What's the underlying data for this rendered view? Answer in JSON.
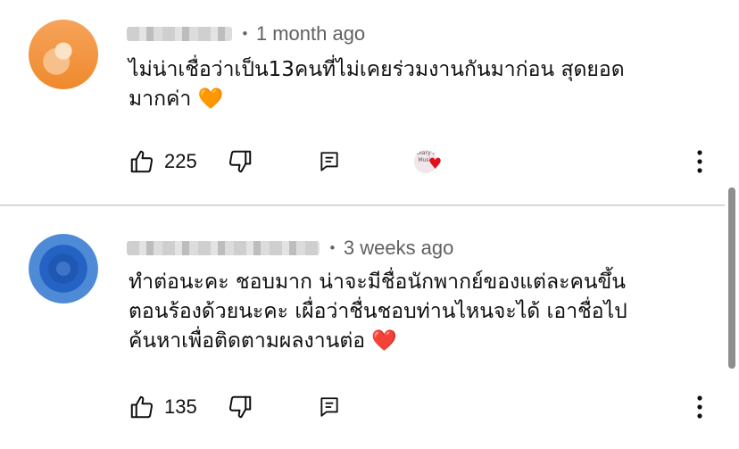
{
  "comments": [
    {
      "time": "1 month ago",
      "text_lines": [
        "ไม่น่าเชื่อว่าเป็น13คนที่ไม่เคยร่วมงานกันมาก่อน สุดยอด",
        "มากค่า 🧡"
      ],
      "likes": "225",
      "creator_heart": true,
      "creator_mini": "Diary's Music"
    },
    {
      "time": "3 weeks ago",
      "text_lines": [
        "ทำต่อนะคะ ชอบมาก น่าจะมีชื่อนักพากย์ของแต่ละคนขึ้น",
        "ตอนร้องด้วยนะคะ เผื่อว่าชื่นชอบท่านไหนจะได้ เอาชื่อไป",
        "ค้นหาเพื่อติดตามผลงานต่อ ❤️"
      ],
      "likes": "135",
      "creator_heart": false
    }
  ],
  "icons": {
    "like": "thumb-up-icon",
    "dislike": "thumb-down-icon",
    "reply": "reply-comment-icon",
    "more": "more-vert-icon",
    "heart": "creator-heart-icon"
  },
  "colors": {
    "meta": "#606060",
    "heart": "#e0101c",
    "text": "#0f0f0f"
  }
}
